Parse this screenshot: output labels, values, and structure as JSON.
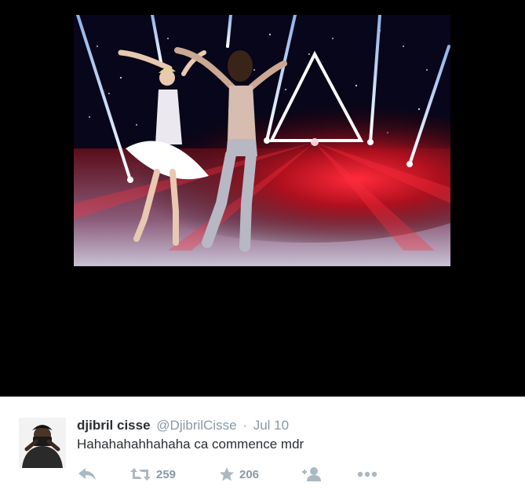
{
  "tweet": {
    "display_name": "djibril cisse",
    "handle": "@DjibrilCisse",
    "separator": "·",
    "timestamp": "Jul 10",
    "text": "Hahahahahhahaha ca commence mdr"
  },
  "actions": {
    "reply": {
      "icon": "reply-icon"
    },
    "retweet": {
      "icon": "retweet-icon",
      "count": "259"
    },
    "favorite": {
      "icon": "star-icon",
      "count": "206"
    },
    "follow": {
      "icon": "follow-icon"
    },
    "more": {
      "icon": "more-dots-icon"
    }
  },
  "colors": {
    "background": "#000000",
    "card": "#ffffff",
    "name": "#292f33",
    "muted": "#8899a6",
    "icon": "#aab8c2",
    "stage_red": "#e0102a"
  }
}
